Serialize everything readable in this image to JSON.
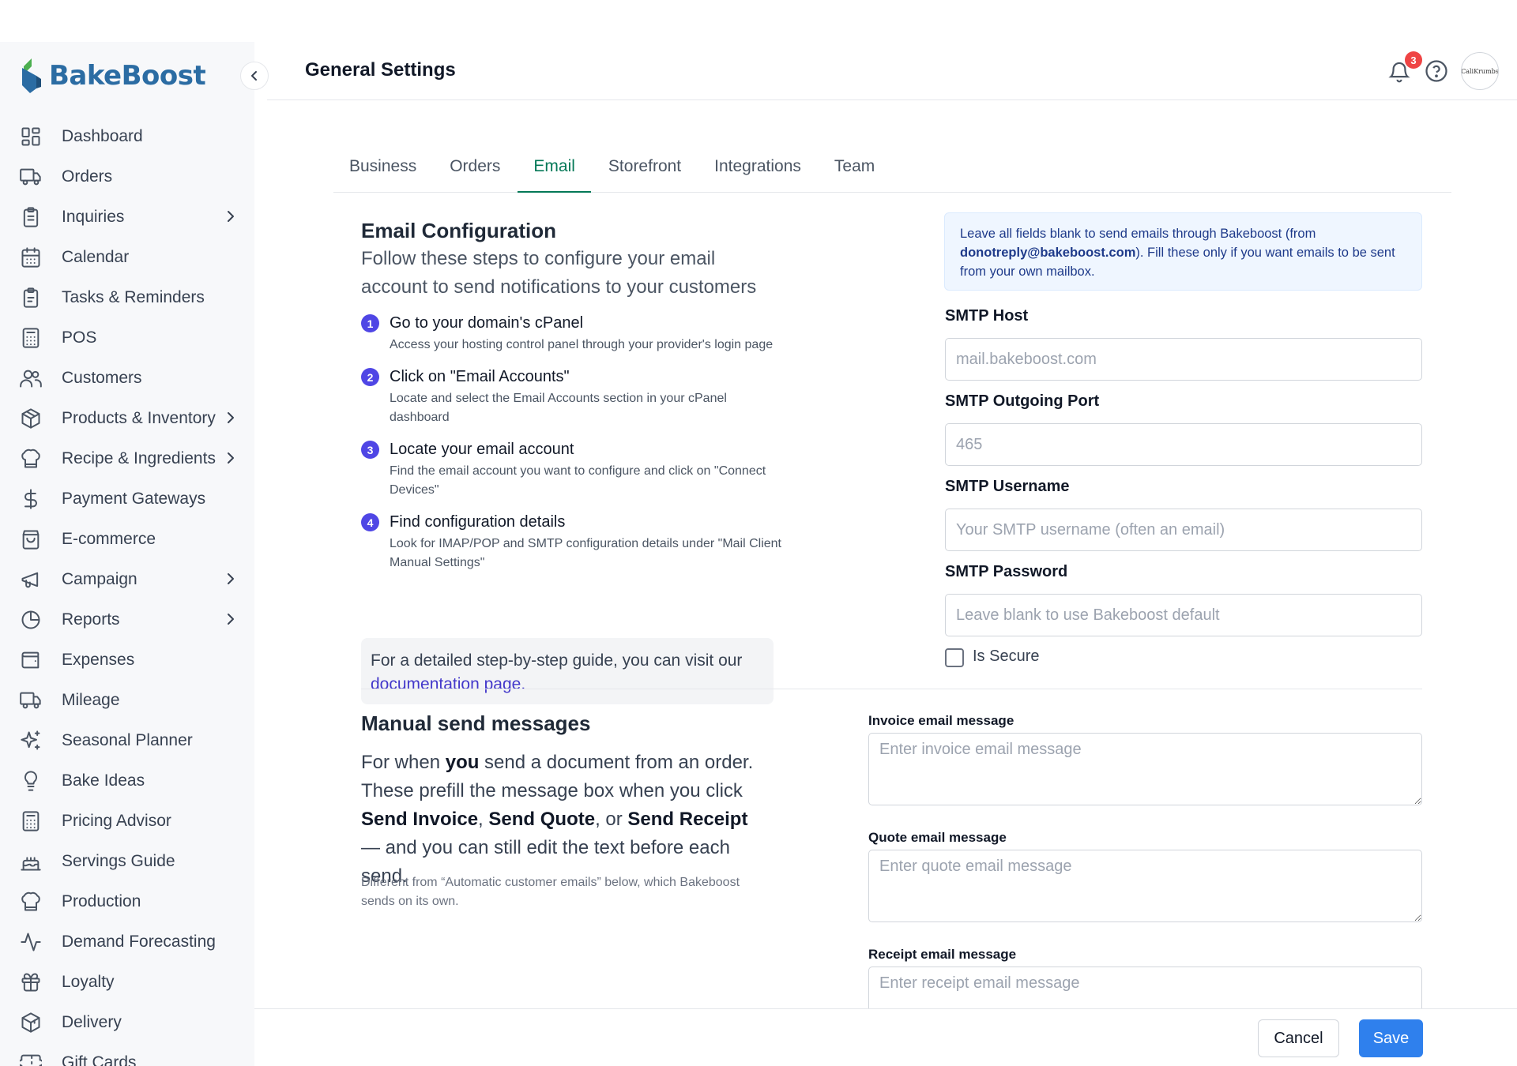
{
  "app": {
    "name": "BakeBoost"
  },
  "header": {
    "title": "General Settings",
    "notification_count": "3",
    "avatar_text": "CaliKrumbs"
  },
  "sidebar": {
    "items": [
      {
        "label": "Dashboard",
        "icon": "dashboard-icon",
        "has_submenu": false
      },
      {
        "label": "Orders",
        "icon": "truck-icon",
        "has_submenu": false
      },
      {
        "label": "Inquiries",
        "icon": "clipboard-icon",
        "has_submenu": true
      },
      {
        "label": "Calendar",
        "icon": "calendar-icon",
        "has_submenu": false
      },
      {
        "label": "Tasks & Reminders",
        "icon": "clipboard-check-icon",
        "has_submenu": false
      },
      {
        "label": "POS",
        "icon": "calculator-icon",
        "has_submenu": false
      },
      {
        "label": "Customers",
        "icon": "users-icon",
        "has_submenu": false
      },
      {
        "label": "Products & Inventory",
        "icon": "box-icon",
        "has_submenu": true
      },
      {
        "label": "Recipe & Ingredients",
        "icon": "chef-hat-icon",
        "has_submenu": true
      },
      {
        "label": "Payment Gateways",
        "icon": "dollar-icon",
        "has_submenu": false
      },
      {
        "label": "E-commerce",
        "icon": "shopping-bag-icon",
        "has_submenu": false
      },
      {
        "label": "Campaign",
        "icon": "megaphone-icon",
        "has_submenu": true
      },
      {
        "label": "Reports",
        "icon": "pie-chart-icon",
        "has_submenu": true
      },
      {
        "label": "Expenses",
        "icon": "wallet-icon",
        "has_submenu": false
      },
      {
        "label": "Mileage",
        "icon": "truck-icon",
        "has_submenu": false
      },
      {
        "label": "Seasonal Planner",
        "icon": "sparkles-icon",
        "has_submenu": false
      },
      {
        "label": "Bake Ideas",
        "icon": "lightbulb-icon",
        "has_submenu": false
      },
      {
        "label": "Pricing Advisor",
        "icon": "calculator-icon",
        "has_submenu": false
      },
      {
        "label": "Servings Guide",
        "icon": "cake-icon",
        "has_submenu": false
      },
      {
        "label": "Production",
        "icon": "chef-hat-icon",
        "has_submenu": false
      },
      {
        "label": "Demand Forecasting",
        "icon": "activity-icon",
        "has_submenu": false
      },
      {
        "label": "Loyalty",
        "icon": "gift-icon",
        "has_submenu": false
      },
      {
        "label": "Delivery",
        "icon": "package-icon",
        "has_submenu": false
      },
      {
        "label": "Gift Cards",
        "icon": "ticket-icon",
        "has_submenu": false
      }
    ]
  },
  "tabs": [
    {
      "label": "Business",
      "active": false
    },
    {
      "label": "Orders",
      "active": false
    },
    {
      "label": "Email",
      "active": true
    },
    {
      "label": "Storefront",
      "active": false
    },
    {
      "label": "Integrations",
      "active": false
    },
    {
      "label": "Team",
      "active": false
    }
  ],
  "email_config": {
    "title": "Email Configuration",
    "subtitle": "Follow these steps to configure your email account to send notifications to your customers",
    "steps": [
      {
        "num": "1",
        "title": "Go to your domain's cPanel",
        "desc": "Access your hosting control panel through your provider's login page"
      },
      {
        "num": "2",
        "title": "Click on \"Email Accounts\"",
        "desc": "Locate and select the Email Accounts section in your cPanel dashboard"
      },
      {
        "num": "3",
        "title": "Locate your email account",
        "desc": "Find the email account you want to configure and click on \"Connect Devices\""
      },
      {
        "num": "4",
        "title": "Find configuration details",
        "desc": "Look for IMAP/POP and SMTP configuration details under \"Mail Client Manual Settings\""
      }
    ],
    "guide_text": "For a detailed step-by-step guide, you can visit our",
    "guide_link": "documentation page.",
    "info_prefix": "Leave all fields blank to send emails through Bakeboost (from",
    "info_email": "donotreply@bakeboost.com",
    "info_suffix": "). Fill these only if you want emails to be sent from your own mailbox.",
    "fields": {
      "host": {
        "label": "SMTP Host",
        "placeholder": "mail.bakeboost.com"
      },
      "port": {
        "label": "SMTP Outgoing Port",
        "placeholder": "465"
      },
      "username": {
        "label": "SMTP Username",
        "placeholder": "Your SMTP username (often an email)"
      },
      "password": {
        "label": "SMTP Password",
        "placeholder": "Leave blank to use Bakeboost default"
      }
    },
    "secure_label": "Is Secure",
    "secure_checked": false
  },
  "manual_send": {
    "title": "Manual send messages",
    "p1": "For when ",
    "you": "you",
    "p2": " send a document from an order. These prefill the message box when you click ",
    "invoice": "Send Invoice",
    "comma1": ", ",
    "quote": "Send Quote",
    "comma2": ", or ",
    "receipt": "Send Receipt",
    "p3": " — and you can still edit the text before each send.",
    "note": "Different from “Automatic customer emails” below, which Bakeboost sends on its own.",
    "invoice_label": "Invoice email message",
    "invoice_placeholder": "Enter invoice email message",
    "quote_label": "Quote email message",
    "quote_placeholder": "Enter quote email message",
    "receipt_label": "Receipt email message",
    "receipt_placeholder": "Enter receipt email message"
  },
  "footer": {
    "cancel_label": "Cancel",
    "save_label": "Save"
  },
  "colors": {
    "accent": "#047857",
    "primary": "#2f80ed",
    "step": "#4f46e5",
    "brand": "#2b6ca3"
  }
}
